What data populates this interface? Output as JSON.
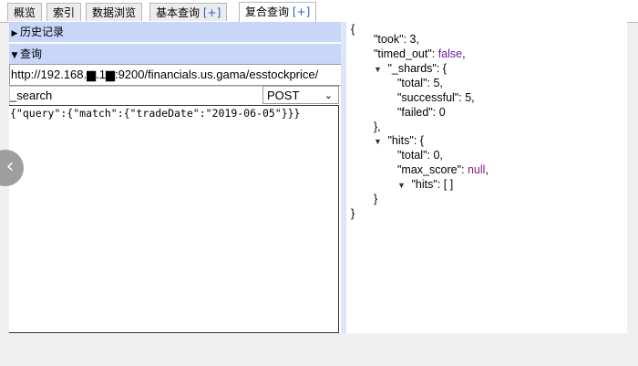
{
  "tabs": [
    {
      "label": "概览",
      "plus": ""
    },
    {
      "label": "索引",
      "plus": ""
    },
    {
      "label": "数据浏览",
      "plus": ""
    },
    {
      "label": "基本查询 ",
      "plus": "[+]"
    },
    {
      "label": "复合查询 ",
      "plus": "[+]"
    }
  ],
  "left": {
    "history_label": "历史记录",
    "query_label": "查询",
    "url": "http://192.168.▆.1▆:9200/financials.us.gama/esstockprice/",
    "path": "_search",
    "method": "POST",
    "body": "{\"query\":{\"match\":{\"tradeDate\":\"2019-06-05\"}}}"
  },
  "response": {
    "open": "{",
    "took_key": "\"took\"",
    "took_val": "3",
    "timed_out_key": "\"timed_out\"",
    "timed_out_val": "false",
    "shards_key": "\"_shards\"",
    "shards_total_key": "\"total\"",
    "shards_total_val": "5",
    "shards_successful_key": "\"successful\"",
    "shards_successful_val": "5",
    "shards_failed_key": "\"failed\"",
    "shards_failed_val": "0",
    "hits_key": "\"hits\"",
    "hits_total_key": "\"total\"",
    "hits_total_val": "0",
    "max_score_key": "\"max_score\"",
    "max_score_val": "null",
    "hits_hits_key": "\"hits\"",
    "hits_hits_val": "[ ]",
    "close_obj": "},",
    "close_hits": "}",
    "close": "}"
  },
  "icons": {
    "collapse": "triangle-down-icon",
    "expand": "triangle-right-icon",
    "nav": "chevron-left-icon"
  }
}
